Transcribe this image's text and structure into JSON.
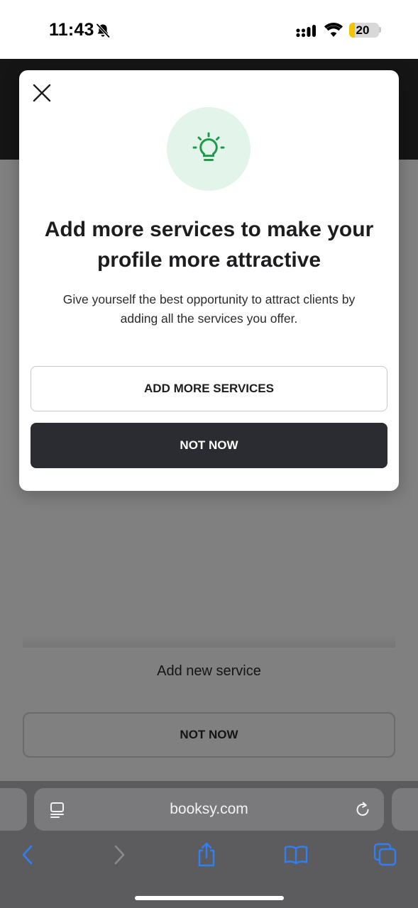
{
  "status_bar": {
    "time": "11:43",
    "battery_level": "20",
    "battery_fraction": 0.2
  },
  "background_page": {
    "add_new_service": "Add new service",
    "not_now_label": "NOT NOW"
  },
  "modal": {
    "icon": "lightbulb-icon",
    "title": "Add more services to make your profile more attractive",
    "description": "Give yourself the best opportunity to attract clients by adding all the services you offer.",
    "primary_button": "ADD MORE SERVICES",
    "secondary_button": "NOT NOW"
  },
  "browser": {
    "url": "booksy.com"
  },
  "colors": {
    "accent_green": "#1e9a4b",
    "icon_bg": "#e3f5ea",
    "dark_button": "#2b2c31",
    "safari_blue": "#2f7ff5"
  }
}
